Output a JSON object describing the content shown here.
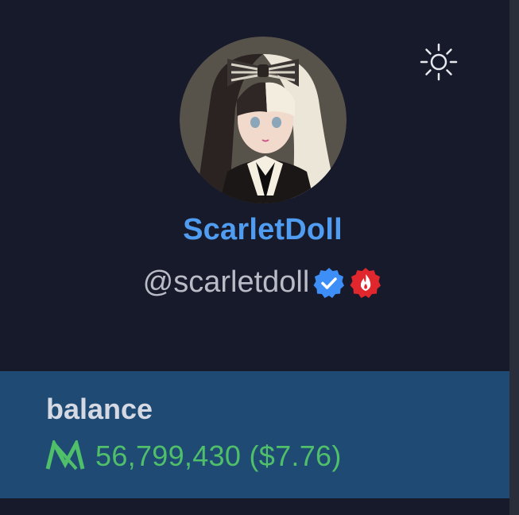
{
  "profile": {
    "display_name": "ScarletDoll",
    "handle": "@scarletdoll",
    "badges": [
      "verified-badge-icon",
      "fire-badge-icon"
    ],
    "avatar": "anime-girl-avatar"
  },
  "header": {
    "settings_icon": "sun-icon"
  },
  "balance": {
    "label": "balance",
    "currency_icon": "m-token-icon",
    "amount_text": "56,799,430 ($7.76)"
  },
  "colors": {
    "background": "#161a2a",
    "accent_name": "#4f9cf0",
    "balance_bg": "#1f4a74",
    "balance_green": "#4fbf6a"
  }
}
